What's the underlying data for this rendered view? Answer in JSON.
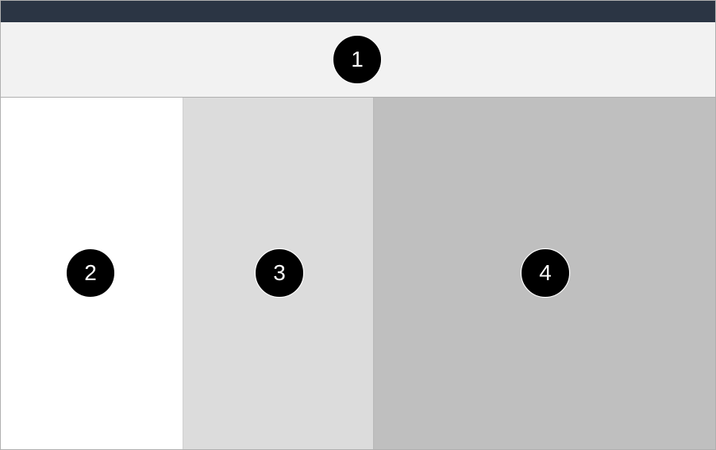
{
  "layout": {
    "markers": {
      "header": "1",
      "left_column": "2",
      "middle_column": "3",
      "right_column": "4"
    },
    "colors": {
      "title_bar": "#2b3544",
      "header": "#f2f2f2",
      "left_column": "#ffffff",
      "middle_column": "#dcdcdc",
      "right_column": "#bfbfbf",
      "badge_bg": "#000000",
      "badge_fg": "#ffffff"
    }
  }
}
